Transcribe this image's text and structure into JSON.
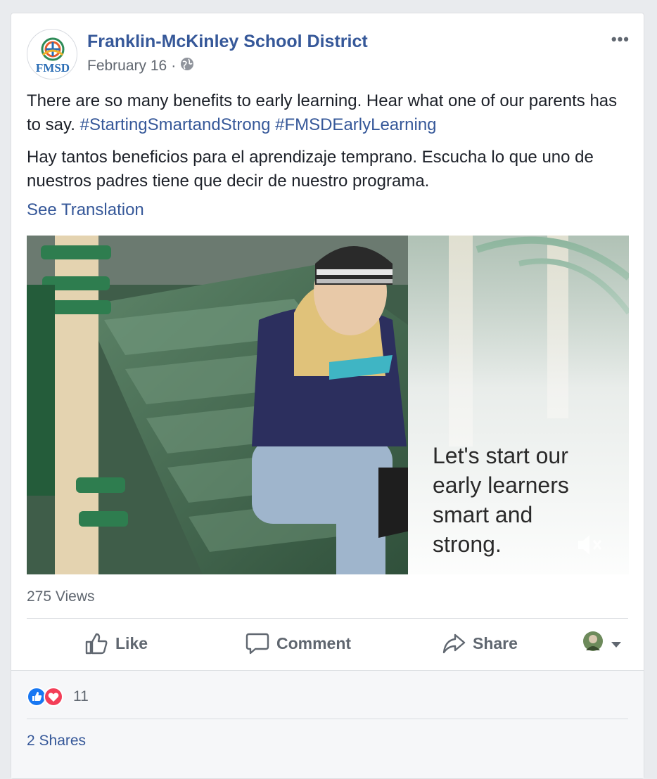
{
  "post": {
    "page_name": "Franklin-McKinley School District",
    "avatar_text": "FMSD",
    "date": "February 16",
    "separator": "·",
    "privacy_icon": "globe-icon",
    "more_label": "•••",
    "text_en_plain": "There are so many benefits to early learning. Hear what one of our parents has to say.",
    "hashtag_1": "#StartingSmartandStrong",
    "hashtag_2": "#FMSDEarlyLearning",
    "text_es": "Hay tantos beneficios para el aprendizaje temprano. Escucha lo que uno de nuestros padres tiene que decir de nuestro programa.",
    "see_translation": "See Translation"
  },
  "video": {
    "caption_line_1": "Let's start our",
    "caption_line_2": "early learners",
    "caption_line_3": "smart and",
    "caption_line_4": "strong.",
    "mute_icon": "speaker-muted-icon"
  },
  "stats": {
    "views": "275 Views",
    "reaction_count": "11",
    "shares": "2 Shares"
  },
  "actions": {
    "like_label": "Like",
    "comment_label": "Comment",
    "share_label": "Share"
  },
  "colors": {
    "link": "#365899",
    "like_blue": "#1877f2",
    "love_red": "#f33e58"
  }
}
